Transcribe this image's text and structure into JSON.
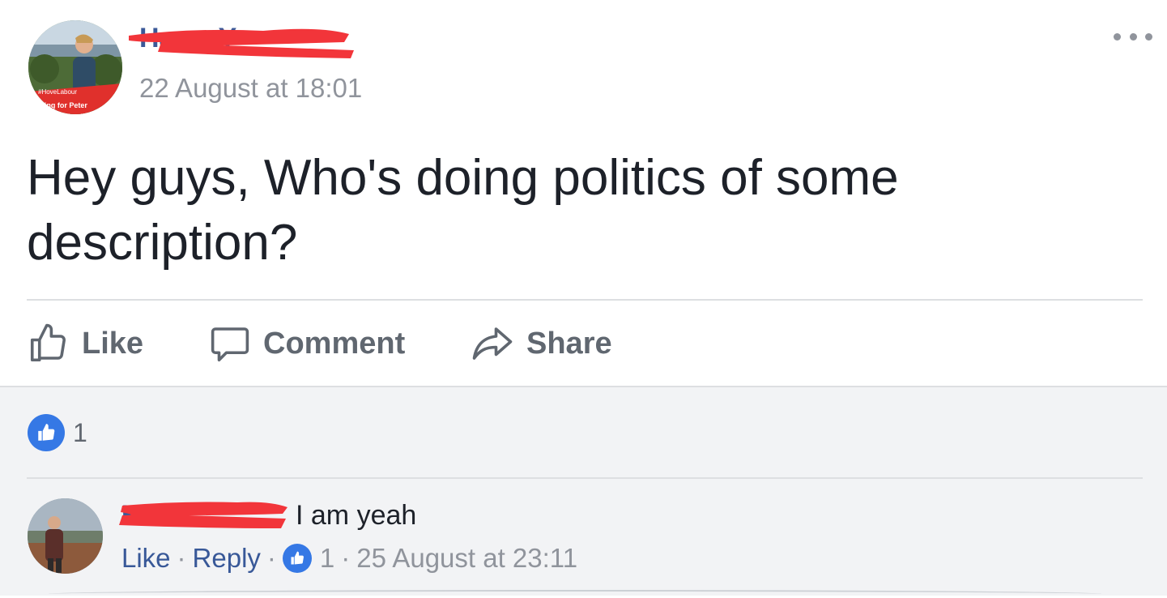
{
  "post": {
    "author_name": "Harry Y",
    "timestamp": "22 August at 18:01",
    "text": "Hey guys, Who's doing politics of some description?",
    "avatar_banner_text": "Voting for Peter",
    "avatar_banner_hashtag": "#HoveLabour"
  },
  "actions": {
    "like": "Like",
    "comment": "Comment",
    "share": "Share"
  },
  "reactions": {
    "count": "1"
  },
  "comment": {
    "author_name": "H",
    "text": "I am yeah",
    "like_label": "Like",
    "reply_label": "Reply",
    "like_count": "1",
    "timestamp": "25 August at 23:11"
  },
  "colors": {
    "link_blue": "#385898",
    "like_blue": "#3578e5",
    "redaction_red": "#f2353a",
    "grey_text": "#90949c"
  }
}
